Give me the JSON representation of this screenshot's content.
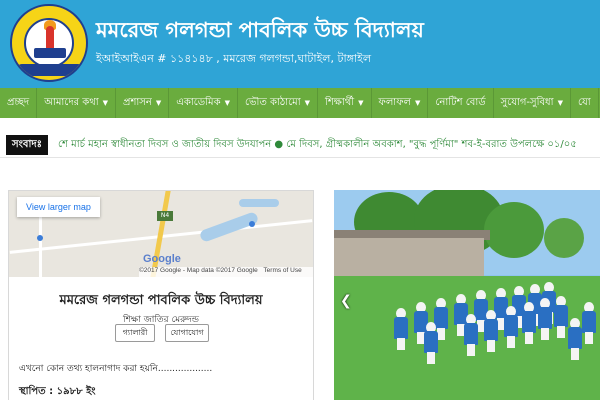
{
  "header": {
    "title": "মমরেজ গলগন্ডা পাবলিক উচ্চ বিদ্যালয়",
    "subtitle": "ইআইআইএন # ১১৪১৪৮ , মমরেজ গলগন্ডা,ঘাটাইল, টাঙ্গাইল",
    "colors": {
      "header_bg": "#2fa4d6",
      "nav_bg": "#6aac3e"
    }
  },
  "nav": {
    "items": [
      {
        "label": "প্রচ্ছদ",
        "dropdown": false
      },
      {
        "label": "আমাদের কথা",
        "dropdown": true
      },
      {
        "label": "প্রশাসন",
        "dropdown": true
      },
      {
        "label": "একাডেমিক",
        "dropdown": true
      },
      {
        "label": "ভৌত কাঠামো",
        "dropdown": true
      },
      {
        "label": "শিক্ষার্থী",
        "dropdown": true
      },
      {
        "label": "ফলাফল",
        "dropdown": true
      },
      {
        "label": "নোটিশ বোর্ড",
        "dropdown": false
      },
      {
        "label": "সুযোগ-সুবিধা",
        "dropdown": true
      },
      {
        "label": "যো",
        "dropdown": false
      }
    ],
    "caret": "▼"
  },
  "ticker": {
    "label": "সংবাদঃ",
    "text": "শে মার্চ মহান স্বাধীনতা দিবস ও জাতীয় দিবস উদযাপন   ●  মে দিবস, গ্রীষ্মকালীন অবকাশ, \"বুদ্ধ পূর্ণিমা\" শব-ই-বরাত উপলক্ষে ০১/০৫"
  },
  "map": {
    "link_label": "View larger map",
    "google_label": "Google",
    "road_shield": "N4",
    "credit": [
      "©2017 Google - Map data ©2017 Google",
      "Terms of Use"
    ]
  },
  "school_card": {
    "title": "মমরেজ গলগন্ডা পাবলিক উচ্চ বিদ্যালয়",
    "motto": "শিক্ষা জাতির মেরুদন্ড",
    "buttons": {
      "gallery": "গ্যালারী",
      "contact": "যোগাযোগ"
    },
    "note": "এখনো কোন তথ্য হালনাগাদ করা হয়নি...................",
    "established": "স্থাপিত : ১৯৮৮ ইং"
  },
  "photo": {
    "prev_arrow": "❮"
  }
}
